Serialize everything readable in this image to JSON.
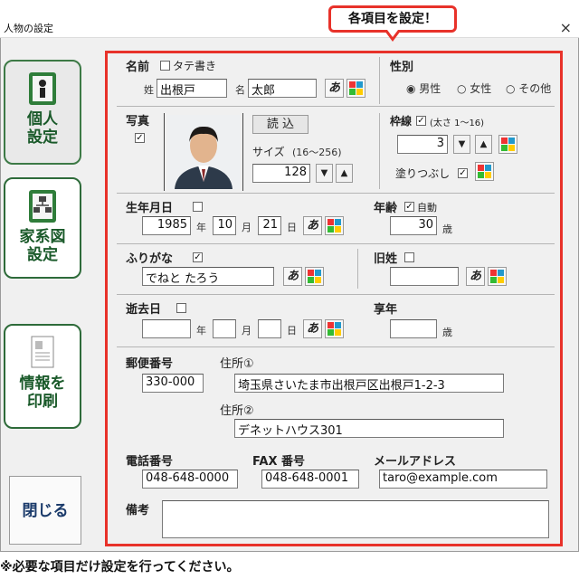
{
  "window": {
    "title": "人物の設定",
    "close_glyph": "×"
  },
  "callout": "各項目を設定！",
  "sidebar": {
    "personal": [
      "個人",
      "設定"
    ],
    "family": [
      "家系図",
      "設定"
    ],
    "print": [
      "情報を",
      "印刷"
    ],
    "close": "閉じる"
  },
  "name": {
    "label": "名前",
    "vertical_label": "タテ書き",
    "last_label": "姓",
    "last_value": "出根戸",
    "first_label": "名",
    "first_value": "太郎"
  },
  "gender": {
    "label": "性別",
    "options": [
      "男性",
      "女性",
      "その他"
    ],
    "selected": "男性"
  },
  "photo": {
    "label": "写真",
    "load_button": "読 込",
    "size_label": "サイズ",
    "size_range": "(16～256)",
    "size_value": "128"
  },
  "border": {
    "label": "枠線",
    "thickness_note": "(太さ 1～16)",
    "value": "3",
    "fill_label": "塗りつぶし"
  },
  "birth": {
    "label": "生年月日",
    "year": "1985",
    "month": "10",
    "day": "21",
    "year_unit": "年",
    "month_unit": "月",
    "day_unit": "日"
  },
  "age": {
    "label": "年齢",
    "auto_label": "自動",
    "value": "30",
    "unit": "歳"
  },
  "furigana": {
    "label": "ふりがな",
    "value": "でねと たろう"
  },
  "old_name": {
    "label": "旧姓",
    "value": ""
  },
  "death": {
    "label": "逝去日",
    "year_unit": "年",
    "month_unit": "月",
    "day_unit": "日"
  },
  "age_at_death": {
    "label": "享年",
    "unit": "歳"
  },
  "address": {
    "postal_label": "郵便番号",
    "postal": "330-000",
    "addr1_label": "住所①",
    "addr1": "埼玉県さいたま市出根戸区出根戸1-2-3",
    "addr2_label": "住所②",
    "addr2": "デネットハウス301"
  },
  "contact": {
    "phone_label": "電話番号",
    "phone": "048-648-0000",
    "fax_label": "FAX 番号",
    "fax": "048-648-0001",
    "email_label": "メールアドレス",
    "email": "taro@example.com"
  },
  "notes": {
    "label": "備考"
  },
  "font_button_label": "あ",
  "footer_note": "※必要な項目だけ設定を行ってください。"
}
